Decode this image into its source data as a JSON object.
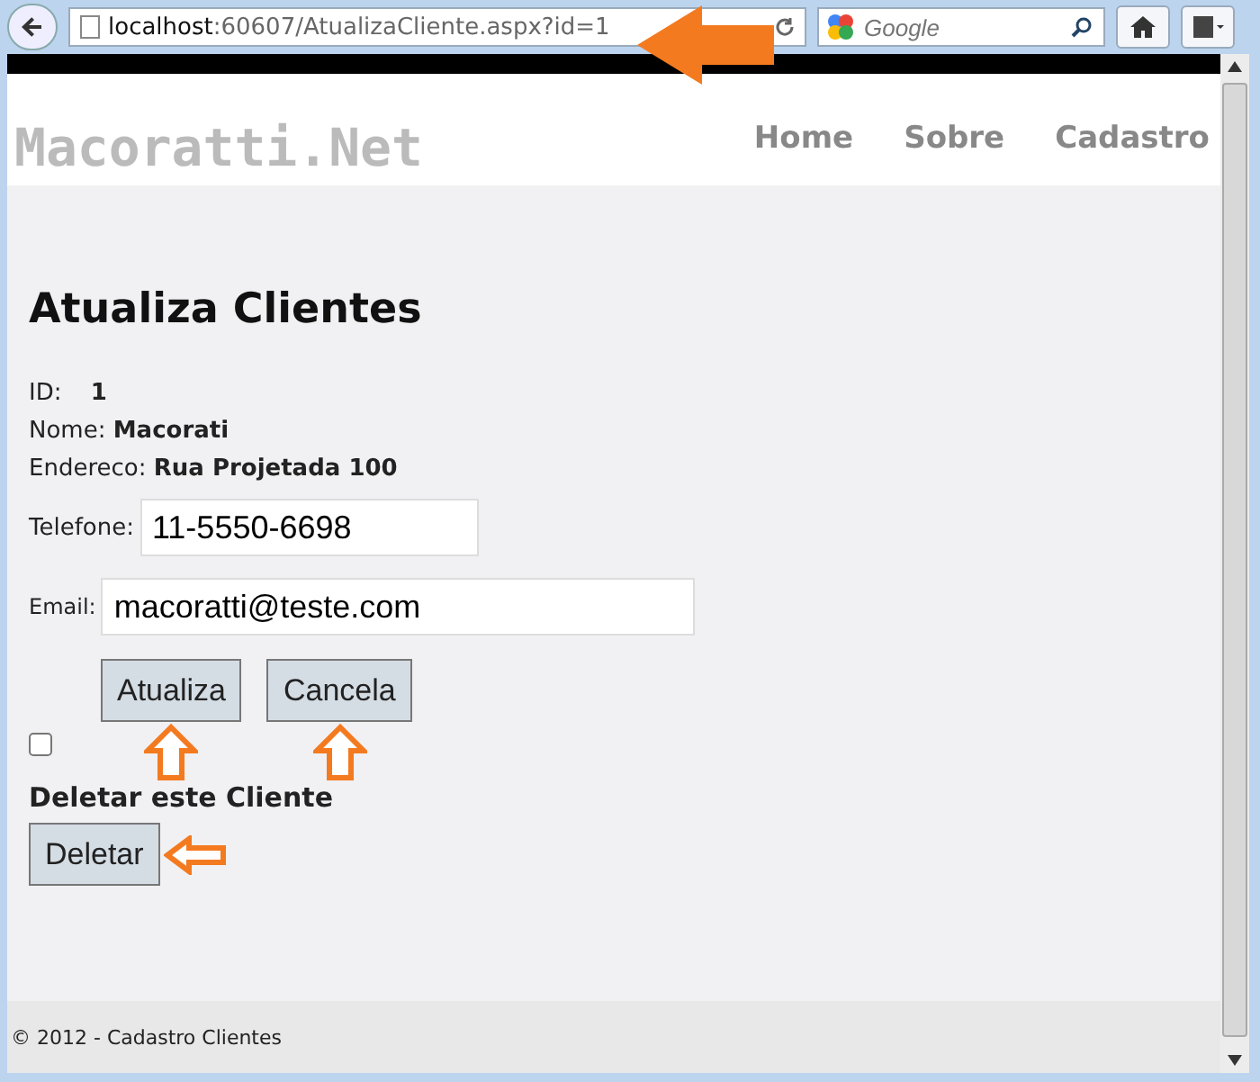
{
  "browser": {
    "url_host": "localhost",
    "url_rest": ":60607/AtualizaCliente.aspx?id=1",
    "search_placeholder": "Google"
  },
  "header": {
    "logo": "Macoratti.Net",
    "nav": [
      "Home",
      "Sobre",
      "Cadastro"
    ]
  },
  "form": {
    "title": "Atualiza Clientes",
    "details": [
      {
        "label": "ID:",
        "value": "1"
      },
      {
        "label": "Nome:",
        "value": "Macorati"
      },
      {
        "label": "Endereco:",
        "value": "Rua Projetada 100"
      }
    ],
    "phone": {
      "label": "Telefone:",
      "value": "11-5550-6698"
    },
    "email": {
      "label": "Email:",
      "value": "macoratti@teste.com"
    },
    "buttons": [
      "Atualiza",
      "Cancela"
    ],
    "delete_checkbox": {
      "checked": false
    },
    "delete_label": "Deletar este Cliente",
    "delete_button": "Deletar"
  },
  "footer": "© 2012 - Cadastro Clientes"
}
